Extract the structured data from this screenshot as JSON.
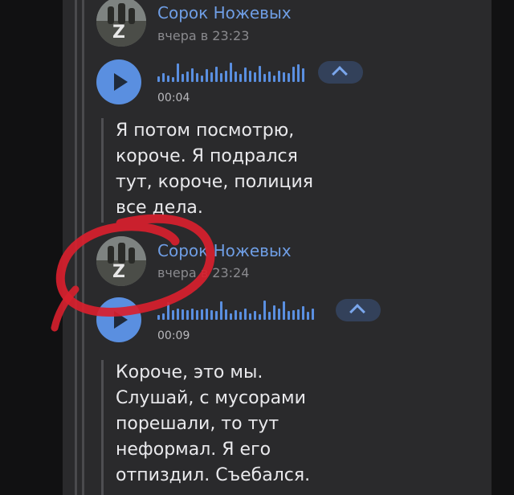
{
  "messages": [
    {
      "author": "Сорок Ножевых",
      "time": "вчера в 23:23",
      "duration": "00:04",
      "transcript": [
        "Я потом посмотрю,",
        "короче. Я подрался",
        "тут, короче, полиция",
        "все дела."
      ],
      "waveform": [
        0.3,
        0.45,
        0.35,
        0.25,
        0.95,
        0.4,
        0.55,
        0.7,
        0.45,
        0.35,
        0.65,
        0.5,
        0.8,
        0.45,
        0.6,
        1.0,
        0.55,
        0.4,
        0.75,
        0.6,
        0.5,
        0.85,
        0.4,
        0.55,
        0.35,
        0.6,
        0.5,
        0.45,
        0.8,
        0.9,
        0.7
      ]
    },
    {
      "author": "Сорок Ножевых",
      "time": "вчера в 23:24",
      "duration": "00:09",
      "transcript": [
        "Короче, это мы.",
        "Слушай, с мусорами",
        "порешали, то тут",
        "неформал. Я его",
        "отпиздил. Съебался."
      ],
      "waveform": [
        0.25,
        0.35,
        0.9,
        0.5,
        0.6,
        0.55,
        0.5,
        0.6,
        0.5,
        0.55,
        0.6,
        0.5,
        0.45,
        0.95,
        0.55,
        0.35,
        0.5,
        0.4,
        0.6,
        0.35,
        0.45,
        0.3,
        1.0,
        0.4,
        0.75,
        0.6,
        0.95,
        0.45,
        0.5,
        0.55,
        0.7,
        0.4,
        0.6
      ]
    }
  ],
  "colors": {
    "accent": "#5a8fe0",
    "author": "#6f9ee5",
    "annotation": "#d8202e"
  },
  "icons": [
    "play-icon",
    "chevron-up-icon"
  ]
}
